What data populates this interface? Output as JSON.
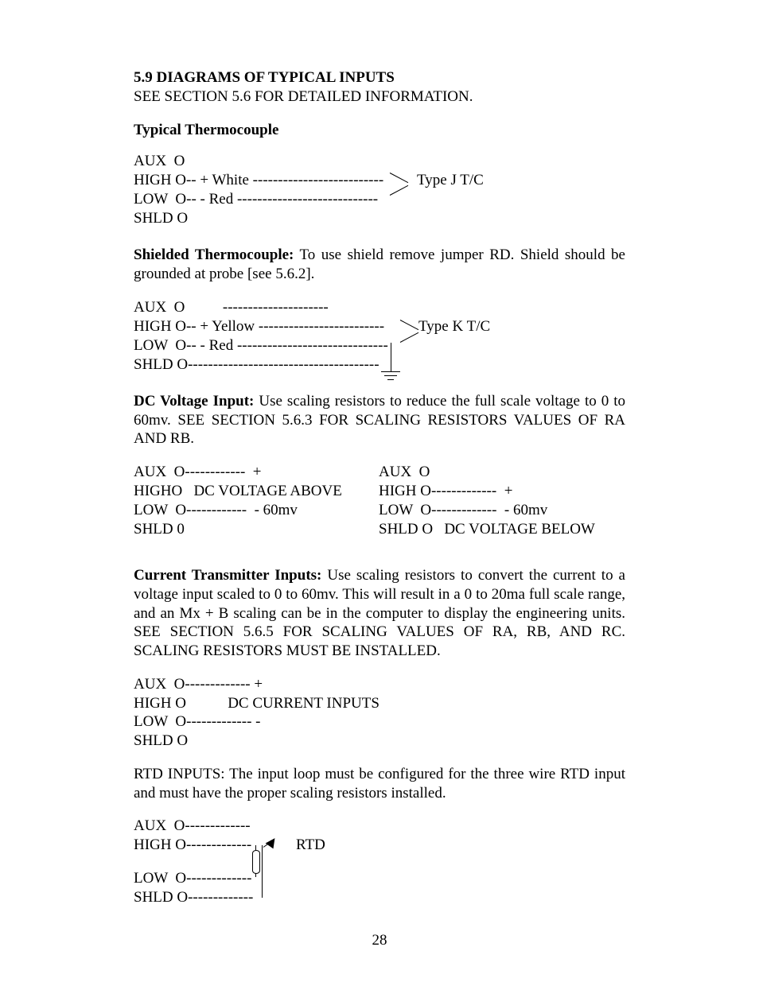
{
  "section": {
    "number": "5.9",
    "title": "DIAGRAMS OF TYPICAL INPUTS",
    "see_note": "SEE SECTION 5.6 FOR DETAILED INFORMATION."
  },
  "typical_thermocouple": {
    "heading": "Typical Thermocouple",
    "aux": "AUX  O",
    "high": "HIGH O-- + White --------------------------",
    "low": "LOW  O-- - Red ----------------------------",
    "shld": "SHLD O",
    "type_label": "Type J T/C"
  },
  "shielded_tc": {
    "run_in": "Shielded Thermocouple:",
    "text": "  To use shield remove jumper RD.  Shield should be grounded at probe [see 5.6.2].",
    "aux": "AUX  O          ---------------------",
    "high": "HIGH O-- + Yellow -------------------------",
    "low": "LOW  O-- - Red ------------------------------",
    "shld": "SHLD O--------------------------------------",
    "type_label": "Type K T/C"
  },
  "dc_voltage": {
    "run_in": "DC Voltage Input:",
    "text": "  Use scaling resistors to reduce the full scale voltage to 0 to 60mv.  SEE SECTION 5.6.3 FOR SCALING RESISTORS VALUES OF RA AND RB.",
    "left": {
      "aux": "AUX  O------------  +",
      "high": "HIGHO   DC VOLTAGE ABOVE",
      "low": "LOW  O------------  - 60mv",
      "shld": "SHLD 0"
    },
    "right": {
      "aux": "AUX  O",
      "high": "HIGH O-------------  +",
      "low": "LOW  O-------------  - 60mv",
      "shld": "SHLD O   DC VOLTAGE BELOW"
    }
  },
  "current_tx": {
    "run_in": "Current Transmitter Inputs:",
    "text": "  Use scaling resistors to convert the current to a voltage input scaled to 0 to 60mv.  This will result in a 0 to 20ma full scale range, and an Mx + B scaling can be in the computer to display the engineering units.  SEE SECTION 5.6.5 FOR SCALING VALUES OF RA, RB, AND RC.  SCALING RESISTORS MUST BE INSTALLED.",
    "aux": "AUX  O------------- +",
    "high": "HIGH O           DC CURRENT INPUTS",
    "low": "LOW  O------------- -",
    "shld": "SHLD O"
  },
  "rtd": {
    "intro": "RTD INPUTS: The input loop must be configured for the three wire RTD input and must have the proper scaling resistors installed.",
    "aux": "AUX  O-------------",
    "high": "HIGH O-------------",
    "low": "LOW  O-------------",
    "shld": "SHLD O-------------",
    "label": "RTD"
  },
  "page_number": "28"
}
